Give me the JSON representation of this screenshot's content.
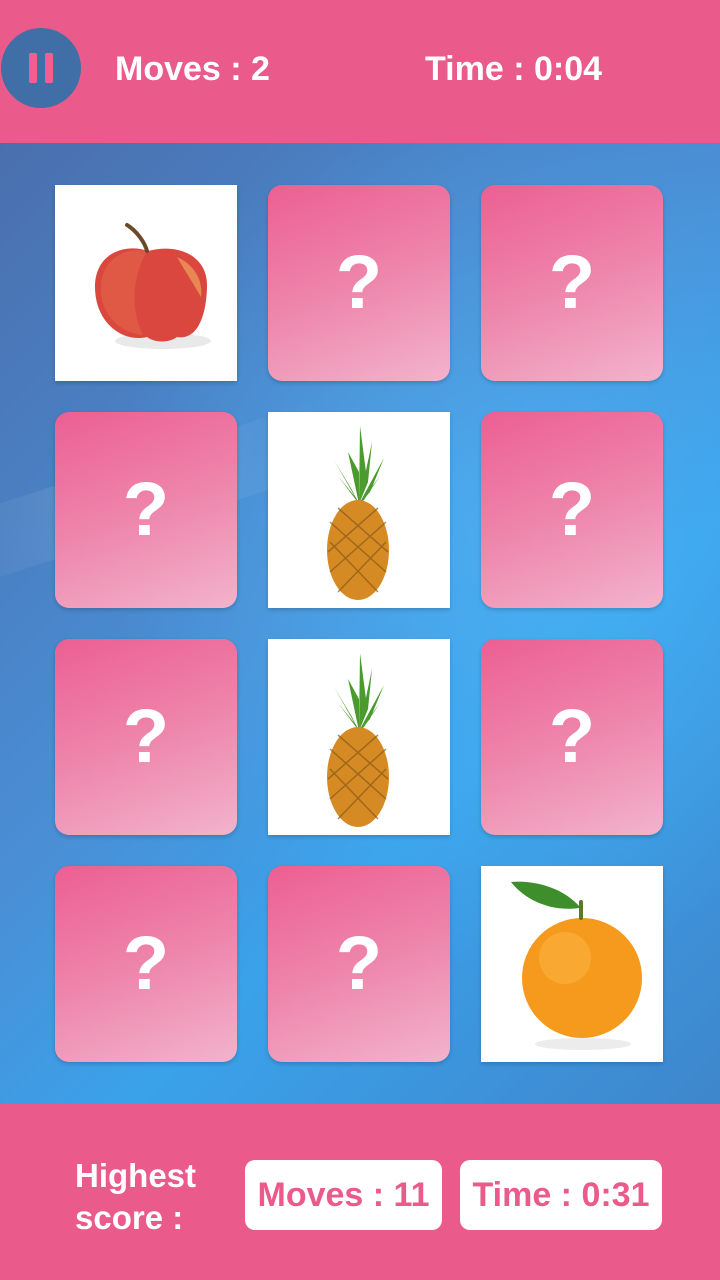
{
  "header": {
    "pause_icon": "pause-icon",
    "moves": "Moves : 2",
    "time": "Time : 0:04"
  },
  "board": {
    "hidden_symbol": "?",
    "cards": [
      {
        "state": "revealed",
        "fruit": "apple"
      },
      {
        "state": "hidden"
      },
      {
        "state": "hidden"
      },
      {
        "state": "hidden"
      },
      {
        "state": "revealed",
        "fruit": "pineapple"
      },
      {
        "state": "hidden"
      },
      {
        "state": "hidden"
      },
      {
        "state": "revealed",
        "fruit": "pineapple"
      },
      {
        "state": "hidden"
      },
      {
        "state": "hidden"
      },
      {
        "state": "hidden"
      },
      {
        "state": "revealed",
        "fruit": "orange"
      }
    ]
  },
  "footer": {
    "highest_label": "Highest score :",
    "best_moves": "Moves : 11",
    "best_time": "Time : 0:31"
  },
  "colors": {
    "accent_pink": "#ea5a8b",
    "pause_circle": "#3f6fa6",
    "background_blue": "#3f86cc"
  }
}
